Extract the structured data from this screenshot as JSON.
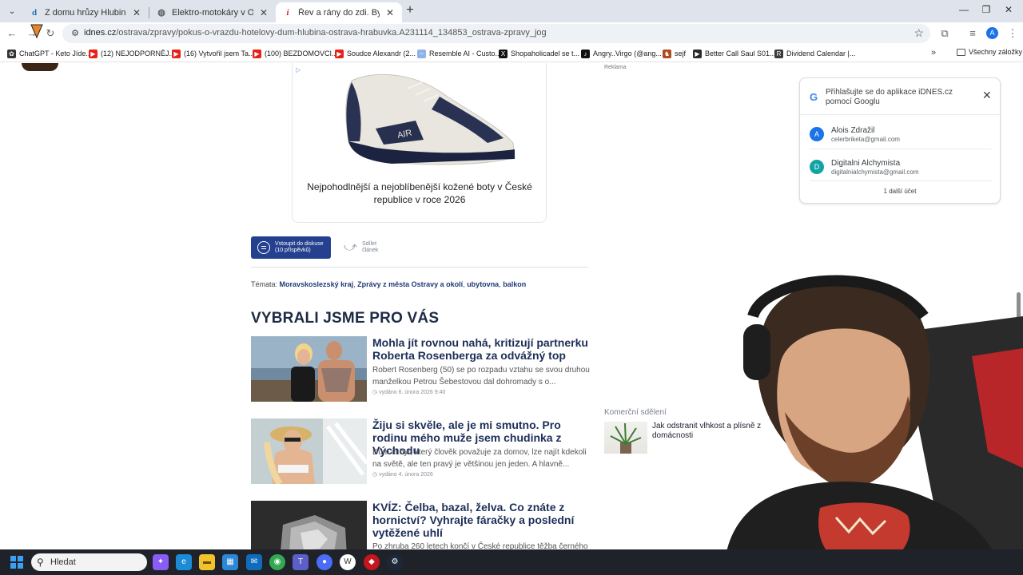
{
  "browser": {
    "tabs": [
      {
        "title": "Z domu hrůzy Hlubina nové bydlení",
        "favicon": "idnes-d-icon",
        "active": false
      },
      {
        "title": "Elektro-motokáry v Ostravě | Elektro",
        "favicon": "globe-icon",
        "active": false
      },
      {
        "title": "Řev a rány do zdi. Bylo tam hodně",
        "favicon": "idnes-i-icon",
        "active": true
      }
    ],
    "new_tab_label": "+",
    "url_host": "idnes.cz",
    "url_path": "/ostrava/zpravy/pokus-o-vrazdu-hotelovy-dum-hlubina-ostrava-hrabuvka.A231114_134853_ostrava-zpravy_jog",
    "profile_initial": "A",
    "bookmarks": [
      {
        "label": "ChatGPT - Keto Jíde...",
        "icon": "chatgpt-icon",
        "color": "#333333"
      },
      {
        "label": "(12) NEJODPORNĚJ...",
        "icon": "youtube-icon",
        "color": "#e62117"
      },
      {
        "label": "(16) Vytvořil jsem Ta...",
        "icon": "youtube-icon",
        "color": "#e62117"
      },
      {
        "label": "(100) BEZDOMOVCI...",
        "icon": "youtube-icon",
        "color": "#e62117"
      },
      {
        "label": "Soudce Alexandr (2...",
        "icon": "youtube-icon",
        "color": "#e62117"
      },
      {
        "label": "Resemble AI - Custo...",
        "icon": "resemble-icon",
        "color": "#8fb3e8"
      },
      {
        "label": "Shopaholicadel se t...",
        "icon": "x-icon",
        "color": "#111111"
      },
      {
        "label": "Angry..Virgo (@ang...",
        "icon": "tiktok-icon",
        "color": "#111111"
      },
      {
        "label": "sejf",
        "icon": "viking-icon",
        "color": "#b04a1f"
      },
      {
        "label": "Better Call Saul S01...",
        "icon": "play-icon",
        "color": "#2a2a2a"
      },
      {
        "label": "Dividend Calendar |...",
        "icon": "tr-icon",
        "color": "#3a3a3a"
      }
    ],
    "bookmarks_more": "»",
    "all_bookmarks_label": "Všechny záložky"
  },
  "article": {
    "ad_text": "Nejpohodlnější a nejoblíbenější kožené boty v České republice v roce 2026",
    "discuss_line1": "Vstoupit do diskuse",
    "discuss_line2": "(10 příspěvků)",
    "share_line1": "Sdílet",
    "share_line2": "článek",
    "topics_label": "Témata:",
    "topics": [
      "Moravskoslezský kraj",
      "Zprávy z města Ostravy a okolí",
      "ubytovna",
      "balkon"
    ],
    "section_title": "VYBRALI JSME PRO VÁS",
    "recommended": [
      {
        "headline": "Mohla jít rovnou nahá, kritizují partnerku Roberta Rosenberga za odvážný top",
        "perex": "Robert Rosenberg (50) se po rozpadu vztahu se svou druhou manželkou Petrou Šebestovou dal dohromady s o...",
        "date": "vydáno 6. února 2026  9:40"
      },
      {
        "headline": "Žiju si skvěle, ale je mi smutno. Pro rodinu mého muže jsem chudinka z Východu",
        "perex": "Dům či byt, který člověk považuje za domov, lze najít kdekoli na světě, ale ten pravý je většinou jen jeden. A hlavně...",
        "date": "vydáno 4. února 2026"
      },
      {
        "headline": "KVÍZ: Čelba, bazal, želva. Co znáte z hornictví? Vyhrajte fáračky a poslední vytěžené uhlí",
        "perex": "Po zhruba 260 letech končí v České republice těžba černého",
        "date": ""
      }
    ]
  },
  "sidebar": {
    "reklama": "Reklama",
    "komercni_title": "Komerční sdělení",
    "komercni_text": "Jak odstranit vlhkost a plísně z domácnosti"
  },
  "google_signin": {
    "title": "Přihlašujte se do aplikace iDNES.cz pomocí Googlu",
    "accounts": [
      {
        "initial": "A",
        "name": "Alois Zdražil",
        "email": "celerbriketa@gmail.com",
        "color": "#1a73e8"
      },
      {
        "initial": "D",
        "name": "Digitalni Alchymista",
        "email": "digitalnialchymista@gmail.com",
        "color": "#12a4a4"
      }
    ],
    "more_accounts": "1 další účet"
  },
  "taskbar": {
    "search_label": "Hledat",
    "apps": [
      {
        "icon": "copilot-icon",
        "color": "#8a5cf6"
      },
      {
        "icon": "edge-icon",
        "color": "#1c8bd6"
      },
      {
        "icon": "file-explorer-icon",
        "color": "#f2c12e"
      },
      {
        "icon": "microsoft-store-icon",
        "color": "#2b88d8"
      },
      {
        "icon": "outlook-icon",
        "color": "#0f6cbd"
      },
      {
        "icon": "chrome-icon",
        "color": "#34a853"
      },
      {
        "icon": "teams-icon",
        "color": "#5b5fc7"
      },
      {
        "icon": "app-icon",
        "color": "#4a6cf7"
      },
      {
        "icon": "wordpress-icon",
        "color": "#ffffff"
      },
      {
        "icon": "red-app-icon",
        "color": "#c4161c"
      },
      {
        "icon": "steam-icon",
        "color": "#1b2838"
      }
    ]
  }
}
